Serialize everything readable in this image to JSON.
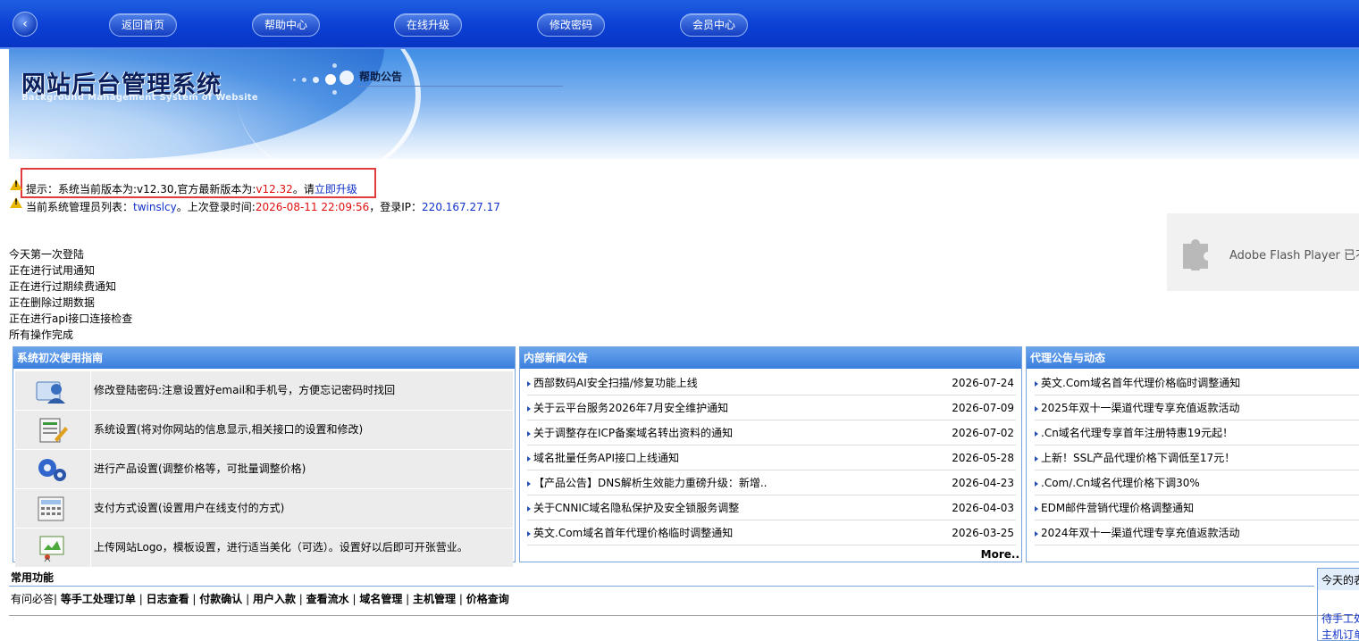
{
  "nav": {
    "back_icon": "‹",
    "items": [
      "返回首页",
      "帮助中心",
      "在线升级",
      "修改密码",
      "会员中心"
    ]
  },
  "banner": {
    "title_cn": "网站后台管理系统",
    "title_en": "Background Management System of Website",
    "section_title": "帮助公告"
  },
  "notice": {
    "prefix": "提示：系统当前版本为:v12.30,官方最新版本为:",
    "latest_version": "v12.32",
    "mid": "。请",
    "upgrade_link": "立即升级"
  },
  "admin": {
    "prefix": "当前系统管理员列表：",
    "name": "twinslcy",
    "login_prefix": "。上次登录时间:",
    "login_time": "2026-08-11 22:09:56",
    "ip_prefix": "，登录IP：",
    "ip": "220.167.27.17"
  },
  "status": [
    "今天第一次登陆",
    "正在进行试用通知",
    "正在进行过期续费通知",
    "正在删除过期数据",
    "正在进行api接口连接检查",
    "所有操作完成"
  ],
  "flash": {
    "text": "Adobe Flash Player 已不"
  },
  "guide": {
    "title": "系统初次使用指南",
    "items": [
      "修改登陆密码:注意设置好email和手机号，方便忘记密码时找回",
      "系统设置(将对你网站的信息显示,相关接口的设置和修改)",
      "进行产品设置(调整价格等，可批量调整价格)",
      "支付方式设置(设置用户在线支付的方式)",
      "上传网站Logo，模板设置，进行适当美化（可选）。设置好以后即可开张营业。"
    ]
  },
  "news": {
    "title": "内部新闻公告",
    "items": [
      {
        "title": "西部数码AI安全扫描/修复功能上线",
        "date": "2026-07-24"
      },
      {
        "title": "关于云平台服务2026年7月安全维护通知",
        "date": "2026-07-09"
      },
      {
        "title": "关于调整存在ICP备案域名转出资料的通知",
        "date": "2026-07-02"
      },
      {
        "title": "域名批量任务API接口上线通知",
        "date": "2026-05-28"
      },
      {
        "title": "【产品公告】DNS解析生效能力重磅升级：新增..",
        "date": "2026-04-23"
      },
      {
        "title": "关于CNNIC域名隐私保护及安全锁服务调整",
        "date": "2026-04-03"
      },
      {
        "title": "英文.Com域名首年代理价格临时调整通知",
        "date": "2026-03-25"
      }
    ],
    "more": "More.."
  },
  "agent": {
    "title": "代理公告与动态",
    "items": [
      "英文.Com域名首年代理价格临时调整通知",
      "2025年双十一渠道代理专享充值返款活动",
      ".Cn域名代理专享首年注册特惠19元起！",
      "上新！SSL产品代理价格下调低至17元！",
      ".Com/.Cn域名代理价格下调30%",
      "EDM邮件营销代理价格调整通知",
      "2024年双十一渠道代理专享充值返款活动"
    ]
  },
  "common": {
    "title": "常用功能",
    "first": "有问必答",
    "links": [
      "等手工处理订单",
      "日志查看",
      "付款确认",
      "用户入款",
      "查看流水",
      "域名管理",
      "主机管理",
      "价格查询"
    ]
  },
  "today": {
    "title": "今天的表",
    "items": [
      "待手工处",
      "主机订单"
    ]
  }
}
